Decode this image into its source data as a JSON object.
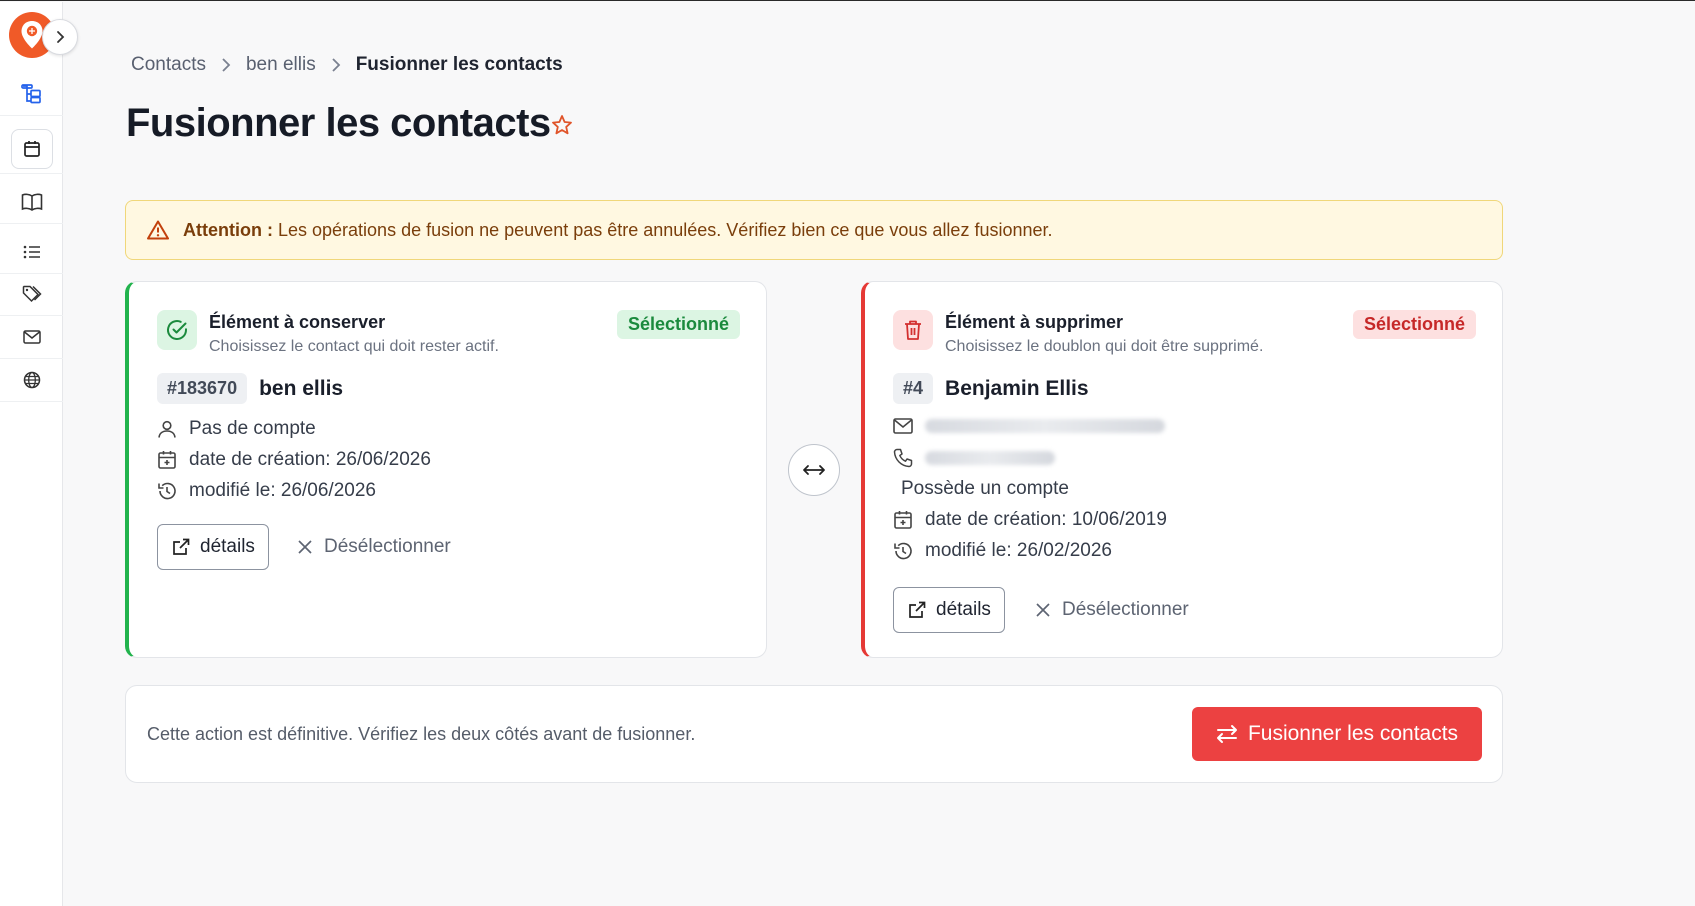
{
  "breadcrumb": {
    "items": [
      "Contacts",
      "ben ellis"
    ],
    "current": "Fusionner les contacts"
  },
  "page": {
    "title": "Fusionner les contacts"
  },
  "alert": {
    "label": "Attention :",
    "message": "Les opérations de fusion ne peuvent pas être annulées. Vérifiez bien ce que vous allez fusionner."
  },
  "keep": {
    "title": "Élément à conserver",
    "subtitle": "Choisissez le contact qui doit rester actif.",
    "badge": "Sélectionné",
    "id": "#183670",
    "name": "ben ellis",
    "account": "Pas de compte",
    "created": "date de création: 26/06/2026",
    "modified": "modifié le: 26/06/2026",
    "details_label": "détails",
    "deselect_label": "Désélectionner"
  },
  "delete": {
    "title": "Élément à supprimer",
    "subtitle": "Choisissez le doublon qui doit être supprimé.",
    "badge": "Sélectionné",
    "id": "#4",
    "name": "Benjamin Ellis",
    "account": "Possède un compte",
    "created": "date de création: 10/06/2019",
    "modified": "modifié le: 26/02/2026",
    "details_label": "détails",
    "deselect_label": "Désélectionner"
  },
  "footer": {
    "text": "Cette action est définitive. Vérifiez les deux côtés avant de fusionner.",
    "merge_label": "Fusionner les contacts"
  },
  "colors": {
    "accent": "#f05a28",
    "keep": "#22b34d",
    "delete": "#e53935",
    "merge_button": "#ec4141"
  },
  "icons": [
    "logo-pin-icon",
    "chevron-right-icon",
    "hierarchy-icon",
    "calendar-icon",
    "book-icon",
    "list-icon",
    "tag-icon",
    "mail-icon",
    "globe-icon",
    "star-icon",
    "warning-icon",
    "check-circle-icon",
    "trash-icon",
    "user-icon",
    "history-icon",
    "external-link-icon",
    "close-icon",
    "swap-icon",
    "phone-icon"
  ]
}
